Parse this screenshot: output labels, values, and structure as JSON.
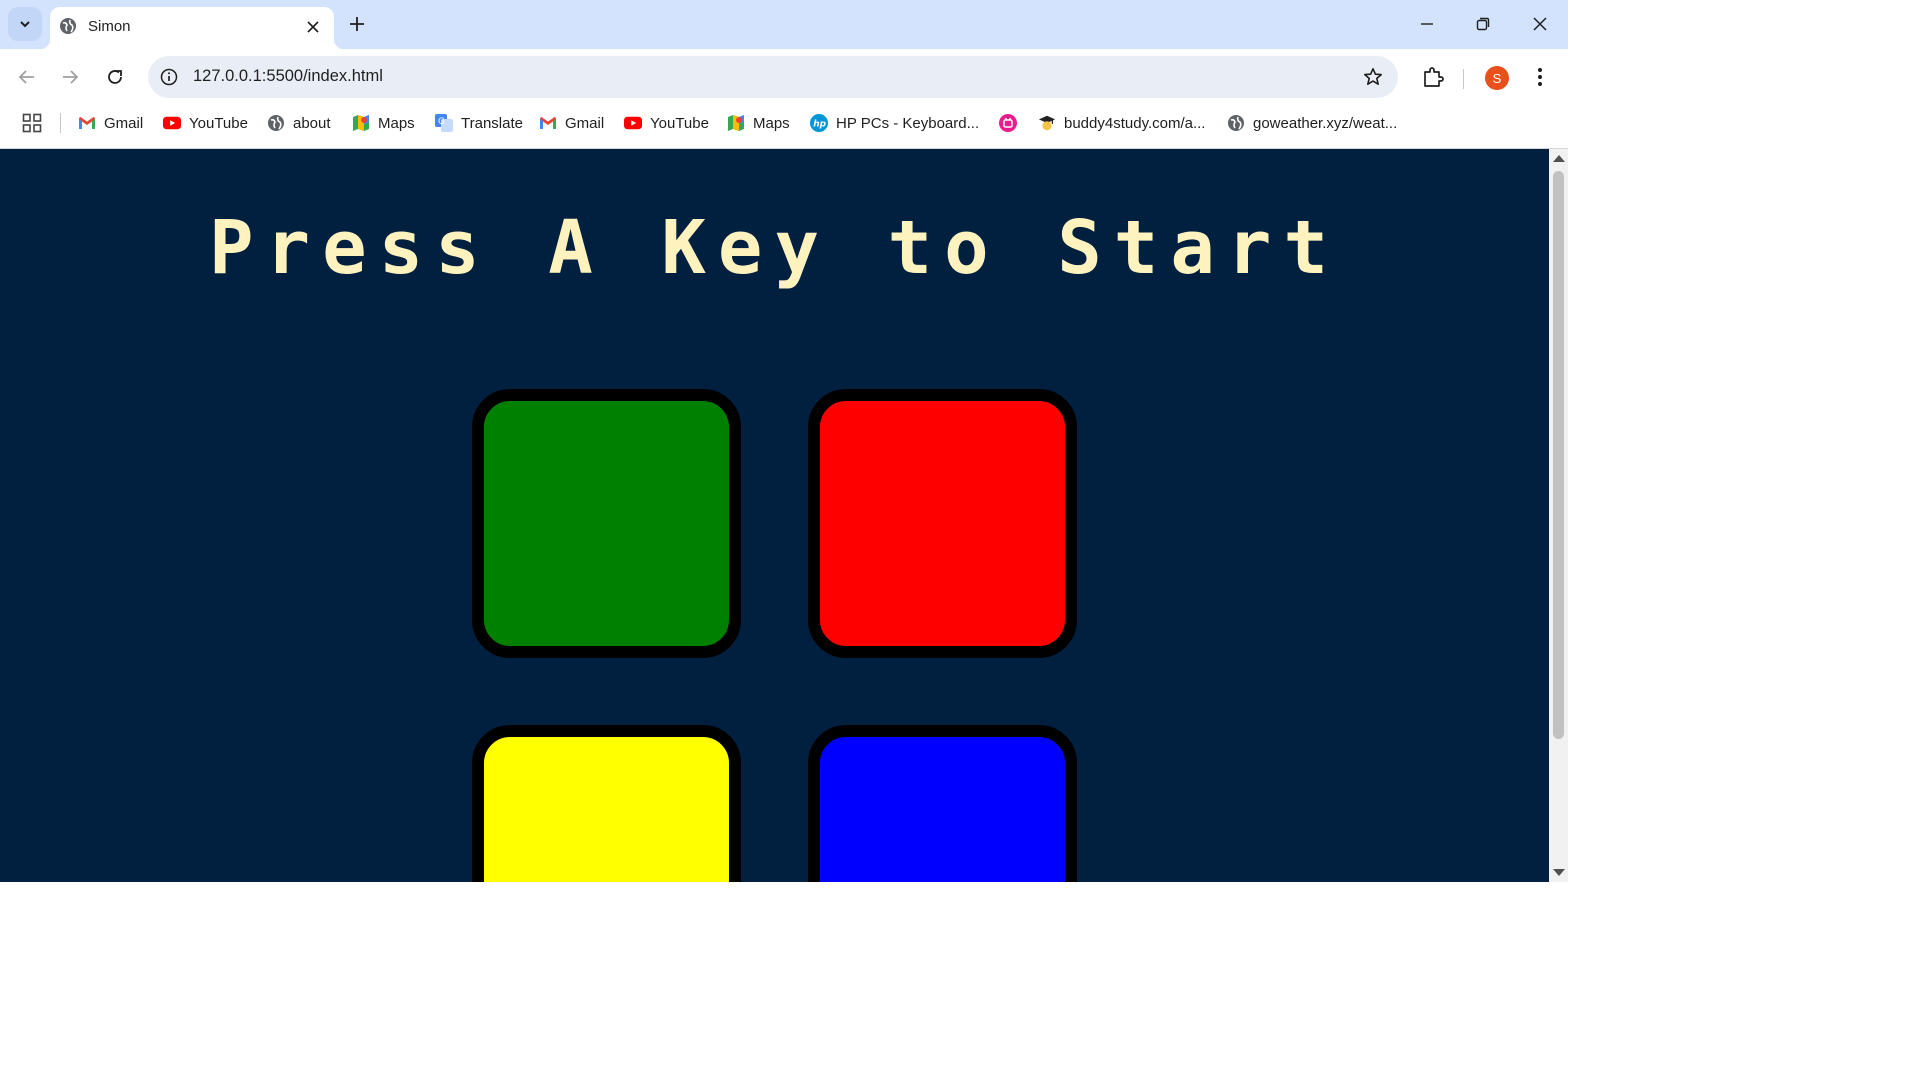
{
  "tab": {
    "title": "Simon"
  },
  "omnibox": {
    "url": "127.0.0.1:5500/index.html"
  },
  "profile": {
    "initial": "S",
    "color": "#e8501c"
  },
  "bookmarks": [
    {
      "label": "Gmail",
      "icon": "gmail-icon"
    },
    {
      "label": "YouTube",
      "icon": "youtube-icon"
    },
    {
      "label": "about",
      "icon": "globe-icon"
    },
    {
      "label": "Maps",
      "icon": "maps-icon"
    },
    {
      "label": "Translate",
      "icon": "translate-icon"
    },
    {
      "label": "Gmail",
      "icon": "gmail-icon"
    },
    {
      "label": "YouTube",
      "icon": "youtube-icon"
    },
    {
      "label": "Maps",
      "icon": "maps-icon"
    },
    {
      "label": "HP PCs - Keyboard...",
      "icon": "hp-icon"
    },
    {
      "label": "",
      "icon": "app-pink-icon"
    },
    {
      "label": "buddy4study.com/a...",
      "icon": "graduate-icon"
    },
    {
      "label": "goweather.xyz/weat...",
      "icon": "globe-icon"
    }
  ],
  "game": {
    "title": "Press A Key to Start",
    "background": "#011f3f",
    "title_color": "#fef2bf",
    "buttons": [
      {
        "name": "green",
        "color": "#008000"
      },
      {
        "name": "red",
        "color": "#ff0000"
      },
      {
        "name": "yellow",
        "color": "#ffff00"
      },
      {
        "name": "blue",
        "color": "#0000ff"
      }
    ]
  }
}
